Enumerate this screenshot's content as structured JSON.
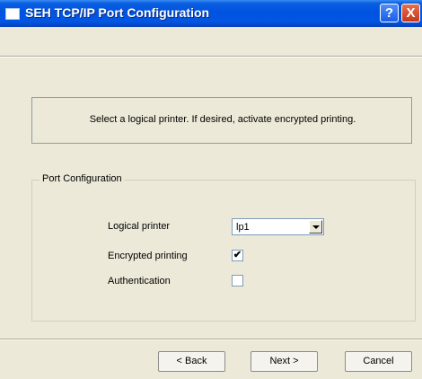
{
  "window": {
    "title": "SEH TCP/IP Port Configuration",
    "help_label": "?",
    "close_label": "X"
  },
  "header": {
    "instruction": "Select a logical printer. If desired, activate encrypted printing."
  },
  "port_configuration": {
    "group_title": "Port Configuration",
    "logical_printer_label": "Logical printer",
    "logical_printer_value": "lp1",
    "encrypted_printing_label": "Encrypted printing",
    "encrypted_printing_checked": true,
    "encrypted_printing_mark": "✔",
    "authentication_label": "Authentication",
    "authentication_checked": false
  },
  "buttons": {
    "back": "< Back",
    "next": "Next >",
    "cancel": "Cancel"
  },
  "colors": {
    "titlebar": "#0053e0",
    "dialog_bg": "#ece9d8",
    "close_button": "#c4381a"
  }
}
